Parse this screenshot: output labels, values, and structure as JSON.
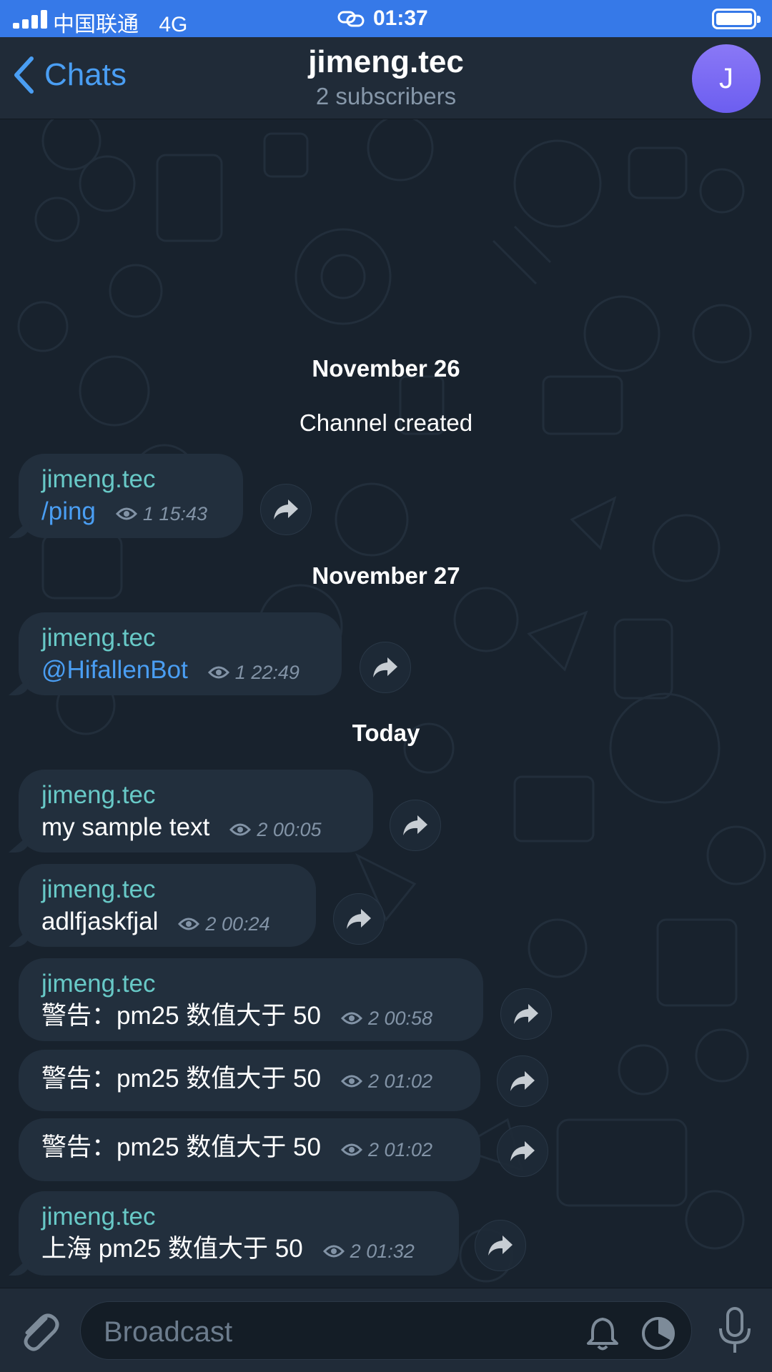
{
  "status_bar": {
    "carrier": "中国联通",
    "network": "4G",
    "time": "01:37"
  },
  "header": {
    "back_label": "Chats",
    "title": "jimeng.tec",
    "subtitle": "2 subscribers",
    "avatar_letter": "J"
  },
  "chat": {
    "dates": [
      "November 26",
      "November 27",
      "Today"
    ],
    "service_message": "Channel created",
    "messages": [
      {
        "sender": "jimeng.tec",
        "text": "/ping",
        "views": "1",
        "time": "15:43"
      },
      {
        "sender": "jimeng.tec",
        "text": "@HifallenBot",
        "views": "1",
        "time": "22:49"
      },
      {
        "sender": "jimeng.tec",
        "text": "my sample text",
        "views": "2",
        "time": "00:05"
      },
      {
        "sender": "jimeng.tec",
        "text": "adlfjaskfjal",
        "views": "2",
        "time": "00:24"
      },
      {
        "sender": "jimeng.tec",
        "text": "警告：pm25 数值大于 50",
        "views": "2",
        "time": "00:58"
      },
      {
        "sender": "",
        "text": "警告：pm25 数值大于 50",
        "views": "2",
        "time": "01:02"
      },
      {
        "sender": "",
        "text": "警告：pm25 数值大于 50",
        "views": "2",
        "time": "01:02"
      },
      {
        "sender": "jimeng.tec",
        "text": "上海 pm25 数值大于 50",
        "views": "2",
        "time": "01:32"
      }
    ]
  },
  "input": {
    "placeholder": "Broadcast"
  },
  "colors": {
    "accent": "#4a9ef3",
    "sender": "#68c9c7",
    "background": "#18222d",
    "bubble": "#222f3d",
    "status_bar": "#3679e8"
  }
}
